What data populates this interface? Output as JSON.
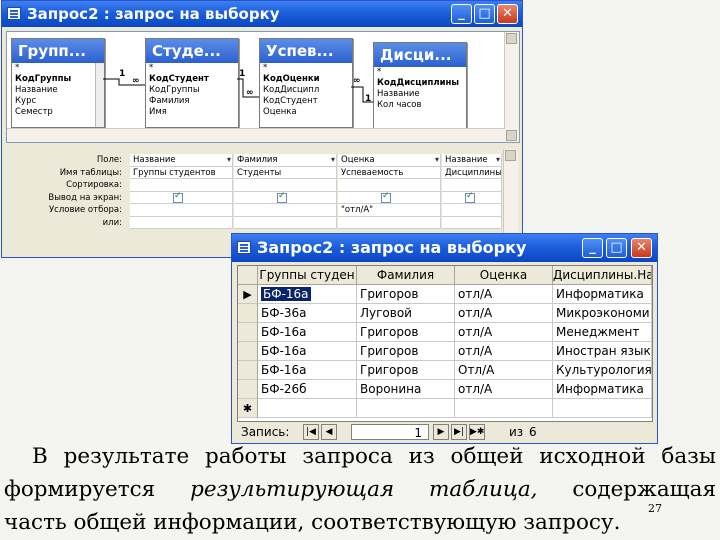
{
  "design_window": {
    "title": "Запрос2 : запрос на выборку",
    "tables": [
      {
        "name": "Групп...",
        "fields": [
          "*",
          "КодГруппы",
          "Название",
          "Курс",
          "Семестр"
        ]
      },
      {
        "name": "Студе...",
        "fields": [
          "*",
          "КодСтудент",
          "КодГруппы",
          "Фамилия",
          "Имя"
        ]
      },
      {
        "name": "Успев...",
        "fields": [
          "*",
          "КодОценки",
          "КодДисципл",
          "КодСтудент",
          "Оценка"
        ]
      },
      {
        "name": "Дисци...",
        "fields": [
          "*",
          "КодДисциплины",
          "Название",
          "Кол часов"
        ]
      }
    ],
    "relation_one": "1",
    "relation_many": "∞",
    "grid_labels": [
      "Поле:",
      "Имя таблицы:",
      "Сортировка:",
      "Вывод на экран:",
      "Условие отбора:",
      "или:"
    ],
    "columns": [
      {
        "field": "Название",
        "table": "Группы студентов",
        "criteria": ""
      },
      {
        "field": "Фамилия",
        "table": "Студенты",
        "criteria": ""
      },
      {
        "field": "Оценка",
        "table": "Успеваемость",
        "criteria": "\"отл/А\""
      },
      {
        "field": "Название",
        "table": "Дисциплины",
        "criteria": ""
      }
    ]
  },
  "result_window": {
    "title": "Запрос2 : запрос на выборку",
    "headers": [
      "Группы студен",
      "Фамилия",
      "Оценка",
      "Дисциплины.На"
    ],
    "rows": [
      [
        "БФ-16а",
        "Григоров",
        "отл/А",
        "Информатика"
      ],
      [
        "БФ-36а",
        "Луговой",
        "отл/А",
        "Микроэкономи"
      ],
      [
        "БФ-16а",
        "Григоров",
        "отл/А",
        "Менеджмент"
      ],
      [
        "БФ-16а",
        "Григоров",
        "отл/А",
        "Иностран язык"
      ],
      [
        "БФ-16а",
        "Григоров",
        "Отл/А",
        "Культурология"
      ],
      [
        "БФ-26б",
        "Воронина",
        "отл/А",
        "Информатика"
      ]
    ],
    "current_marker": "▶",
    "new_marker": "✱",
    "nav": {
      "label": "Запись:",
      "current": "1",
      "of_label": "из",
      "total": "6"
    }
  },
  "slide": {
    "line1": "В результате работы запроса из общей исходной базы",
    "line2_a": "формируется ",
    "line2_b": "результирующая таблица,",
    "line2_c": " содержащая",
    "line3": "часть общей информации, соответствующую запросу.",
    "page_number": "27"
  }
}
